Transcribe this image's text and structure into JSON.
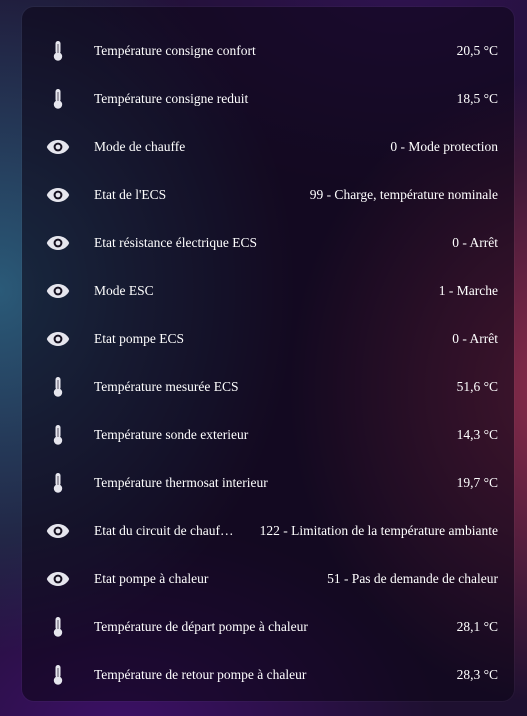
{
  "colors": {
    "text": "#ffffff",
    "icon": "#e6e6ee",
    "card": "#0c0616"
  },
  "rows": [
    {
      "icon": "thermometer-icon",
      "label": "Température consigne confort",
      "value": "20,5 °C"
    },
    {
      "icon": "thermometer-icon",
      "label": "Température consigne reduit",
      "value": "18,5 °C"
    },
    {
      "icon": "eye-icon",
      "label": "Mode de chauffe",
      "value": "0 - Mode protection"
    },
    {
      "icon": "eye-icon",
      "label": "Etat de l'ECS",
      "value": "99 - Charge, température nominale"
    },
    {
      "icon": "eye-icon",
      "label": "Etat résistance électrique ECS",
      "value": "0 - Arrêt"
    },
    {
      "icon": "eye-icon",
      "label": "Mode ESC",
      "value": "1 - Marche"
    },
    {
      "icon": "eye-icon",
      "label": "Etat pompe ECS",
      "value": "0 - Arrêt"
    },
    {
      "icon": "thermometer-icon",
      "label": "Température mesurée ECS",
      "value": "51,6 °C"
    },
    {
      "icon": "thermometer-icon",
      "label": "Température sonde exterieur",
      "value": "14,3 °C"
    },
    {
      "icon": "thermometer-icon",
      "label": "Température thermosat interieur",
      "value": "19,7 °C"
    },
    {
      "icon": "eye-icon",
      "label": "Etat du circuit de chauf…",
      "value": "122 - Limitation de la température ambiante"
    },
    {
      "icon": "eye-icon",
      "label": "Etat pompe à chaleur",
      "value": "51 - Pas de demande de chaleur"
    },
    {
      "icon": "thermometer-icon",
      "label": "Température de départ pompe à chaleur",
      "value": "28,1 °C"
    },
    {
      "icon": "thermometer-icon",
      "label": "Température de retour pompe à chaleur",
      "value": "28,3 °C"
    }
  ]
}
